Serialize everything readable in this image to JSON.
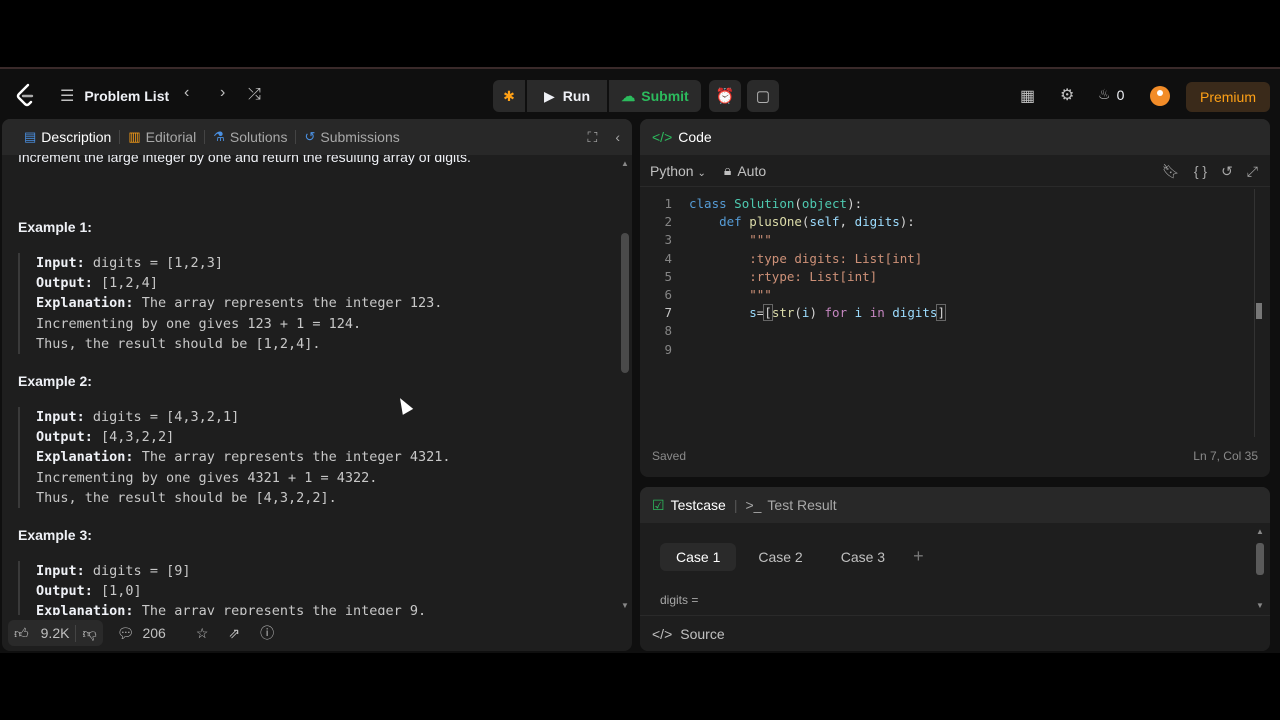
{
  "topbar": {
    "problem_list": "Problem List",
    "run": "Run",
    "submit": "Submit",
    "streak_count": "0",
    "premium": "Premium"
  },
  "left": {
    "tabs": [
      "Description",
      "Editorial",
      "Solutions",
      "Submissions"
    ],
    "cut_text": "Increment the large integer by one and return the resulting array of digits.",
    "examples": [
      {
        "title": "Example 1:",
        "input": "digits = [1,2,3]",
        "output": "[1,2,4]",
        "explanation": "The array represents the integer 123.",
        "extra1": "Incrementing by one gives 123 + 1 = 124.",
        "extra2": "Thus, the result should be [1,2,4]."
      },
      {
        "title": "Example 2:",
        "input": "digits = [4,3,2,1]",
        "output": "[4,3,2,2]",
        "explanation": "The array represents the integer 4321.",
        "extra1": "Incrementing by one gives 4321 + 1 = 4322.",
        "extra2": "Thus, the result should be [4,3,2,2]."
      },
      {
        "title": "Example 3:",
        "input": "digits = [9]",
        "output": "[1,0]",
        "explanation": "The array represents the integer 9."
      }
    ],
    "labels": {
      "input": "Input:",
      "output": "Output:",
      "explanation": "Explanation:"
    },
    "footer": {
      "likes": "9.2K",
      "comments": "206"
    }
  },
  "code": {
    "title": "Code",
    "language": "Python",
    "mode": "Auto",
    "status": "Saved",
    "cursor": "Ln 7, Col 35"
  },
  "testcase": {
    "tab": "Testcase",
    "result_tab": "Test Result",
    "cases": [
      "Case 1",
      "Case 2",
      "Case 3"
    ],
    "digits_label": "digits =",
    "source": "Source"
  }
}
